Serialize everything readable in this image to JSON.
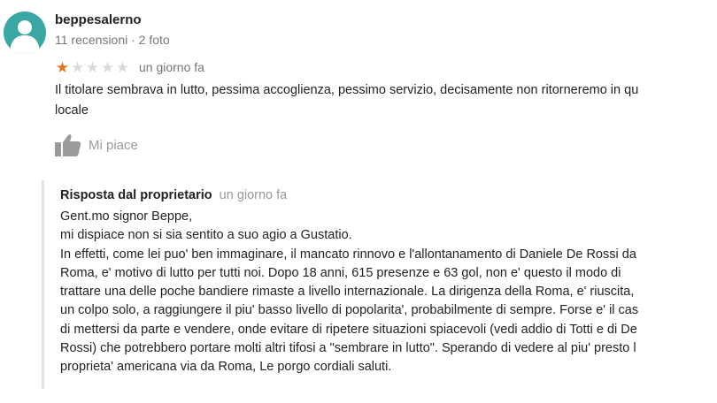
{
  "review": {
    "author": "beppesalerno",
    "meta": "11 recensioni · 2 foto",
    "rating": 1,
    "rating_max": 5,
    "star_color": "#e7711b",
    "time": "un giorno fa",
    "text_lines": [
      "Il titolare sembrava in lutto, pessima accoglienza, pessimo servizio, decisamente non ritorneremo in qu",
      "locale"
    ],
    "like_icon": "thumbs-up-icon",
    "like_label": "Mi piace"
  },
  "owner_reply": {
    "title": "Risposta dal proprietario",
    "time": "un giorno fa",
    "lines": [
      "Gent.mo signor Beppe,",
      "mi dispiace non si sia sentito a suo agio a Gustatio.",
      "In effetti, come lei puo' ben immaginare, il mancato rinnovo e l'allontanamento di Daniele De Rossi da",
      "Roma, e' motivo di lutto per tutti noi. Dopo 18 anni, 615 presenze e 63 gol, non e' questo il modo di",
      "trattare una delle poche bandiere rimaste a livello internazionale. La dirigenza della Roma, e' riuscita,",
      "un colpo solo, a raggiungere il piu' basso livello di popolarita', probabilmente di sempre. Forse e' il cas",
      "di mettersi da parte e vendere, onde evitare di ripetere situazioni spiacevoli (vedi addio di Totti e di De",
      "Rossi) che potrebbero portare molti altri tifosi a \"sembrare in lutto\". Sperando di vedere al piu' presto l",
      "proprieta' americana via da Roma, Le porgo cordiali saluti."
    ]
  }
}
